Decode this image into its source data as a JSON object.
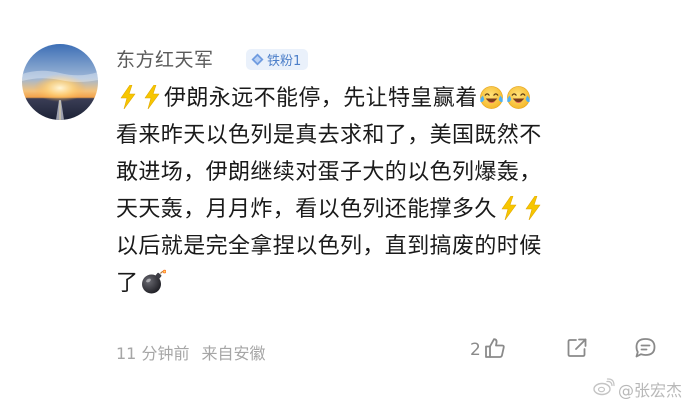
{
  "comment": {
    "author": "东方红天军",
    "badge": "铁粉1",
    "lines": [
      {
        "before": "",
        "text": "伊朗永远不能停，先让特皇赢着"
      },
      {
        "text": "看来昨天以色列是真去求和了，美国既然不"
      },
      {
        "text": "敢进场，伊朗继续对蛋子大的以色列爆轰，"
      },
      {
        "text": "天天轰，月月炸，看以色列还能撑多久"
      },
      {
        "text": "以后就是完全拿捏以色列，直到搞废的时候"
      },
      {
        "text": "了"
      }
    ],
    "emoji": [
      "lightning-emoji",
      "laughing-tears-emoji",
      "bomb-emoji"
    ],
    "timestamp": "11 分钟前",
    "source": "来自安徽",
    "like_count": "2"
  },
  "watermark": {
    "text": "@张宏杰"
  },
  "colors": {
    "author": "#5a5a5a",
    "badge_bg": "#eaf1fb",
    "badge_text": "#4d7fc9",
    "meta": "#a6a6a6",
    "icons": "#8a8a8a"
  }
}
